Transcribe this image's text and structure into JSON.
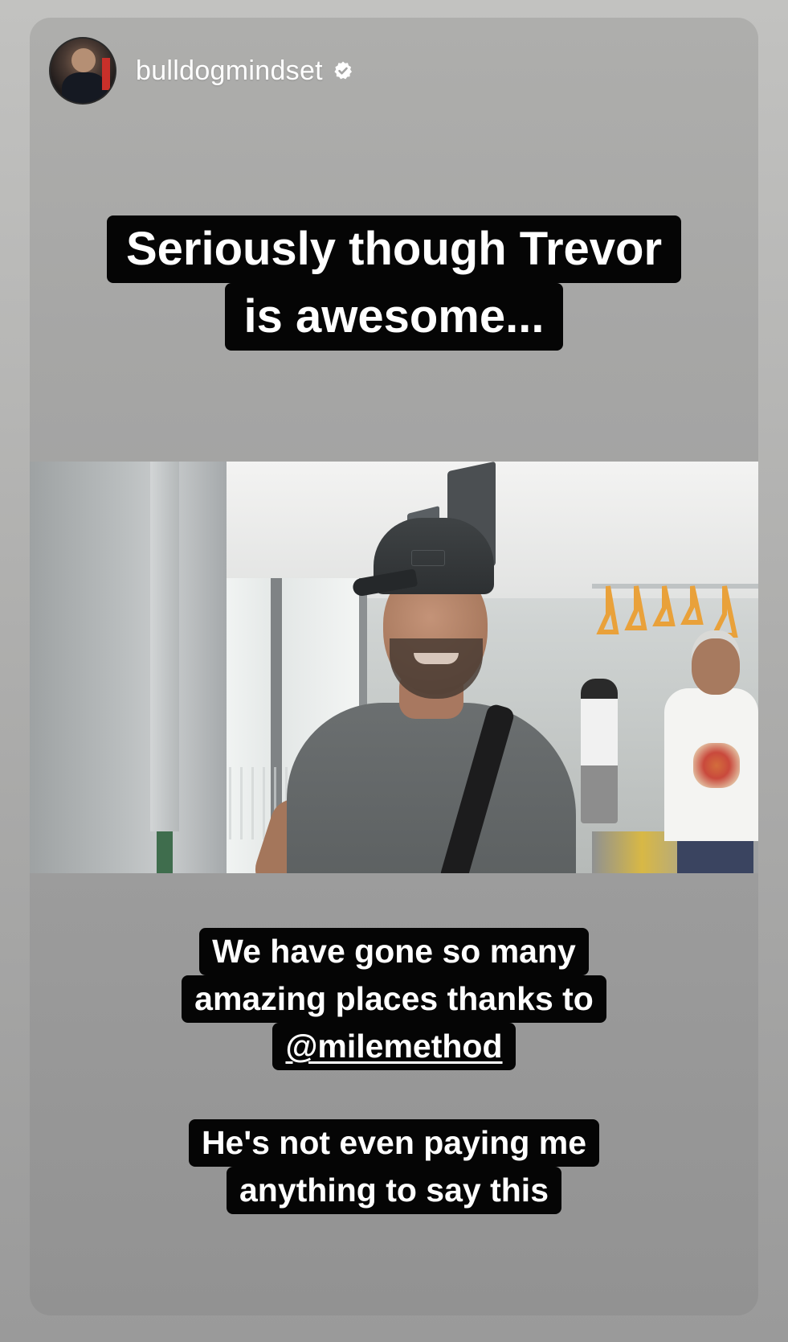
{
  "story": {
    "username": "bulldogmindset",
    "verified": true,
    "icons": {
      "avatar": "profile-avatar",
      "verified": "verified-badge-icon"
    },
    "colors": {
      "caption_background": "#050505",
      "caption_text": "#ffffff",
      "card_background": "#a6a6a5"
    }
  },
  "captions": {
    "top": {
      "line1": "Seriously though Trevor",
      "line2": "is awesome..."
    },
    "middle": {
      "line1": "We have gone so many",
      "line2": "amazing places thanks to",
      "mention": "@milemethod"
    },
    "bottom": {
      "line1": "He's not even paying me",
      "line2": "anything to say this"
    }
  },
  "media": {
    "type": "photo"
  }
}
